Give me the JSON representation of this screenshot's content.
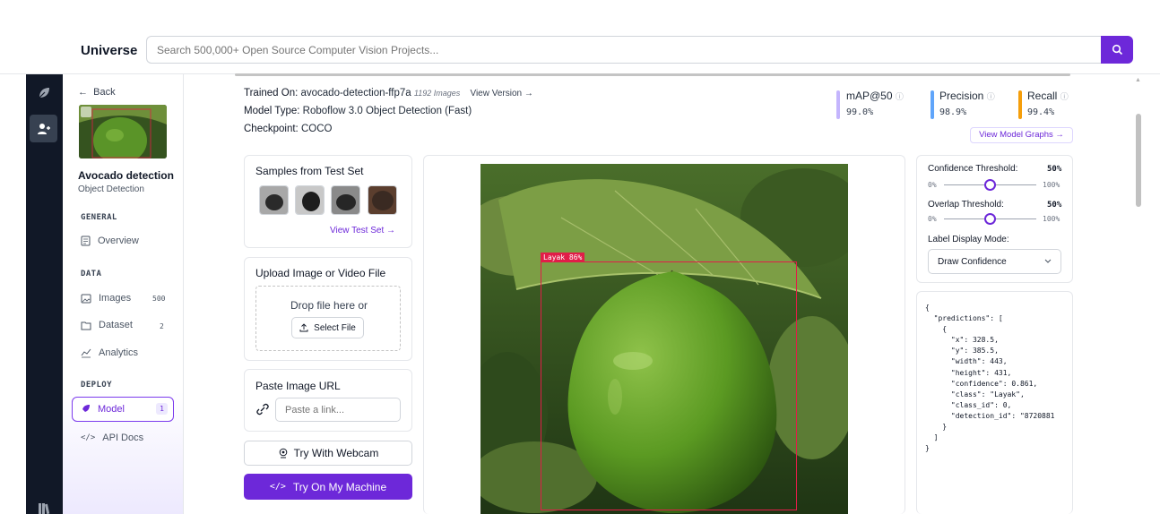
{
  "header": {
    "brand": "Universe",
    "search_placeholder": "Search 500,000+ Open Source Computer Vision Projects..."
  },
  "sidebar": {
    "back_label": "Back",
    "project_title": "Avocado detection",
    "project_type": "Object Detection",
    "sections": {
      "general": "GENERAL",
      "data": "DATA",
      "deploy": "DEPLOY"
    },
    "items": {
      "overview": "Overview",
      "images": "Images",
      "images_count": "500",
      "dataset": "Dataset",
      "dataset_count": "2",
      "analytics": "Analytics",
      "model": "Model",
      "model_count": "1",
      "api_docs": "API Docs"
    }
  },
  "model_info": {
    "trained_on_key": "Trained On:",
    "trained_on_value": "avocado-detection-ffp7a",
    "images_note": "1192 Images",
    "view_version": "View Version →",
    "model_type_key": "Model Type:",
    "model_type_value": "Roboflow 3.0 Object Detection (Fast)",
    "checkpoint_key": "Checkpoint:",
    "checkpoint_value": "COCO"
  },
  "metrics": {
    "map_label": "mAP@50",
    "map_value": "99.0%",
    "precision_label": "Precision",
    "precision_value": "98.9%",
    "recall_label": "Recall",
    "recall_value": "99.4%",
    "graphs_link": "View Model Graphs →",
    "colors": {
      "map": "#c4b5fd",
      "precision": "#60a5fa",
      "recall": "#f59e0b"
    }
  },
  "samples": {
    "title": "Samples from Test Set",
    "view_link": "View Test Set →"
  },
  "upload": {
    "title": "Upload Image or Video File",
    "drop_text": "Drop file here or",
    "select_button": "Select File"
  },
  "paste": {
    "title": "Paste Image URL",
    "placeholder": "Paste a link..."
  },
  "actions": {
    "webcam": "Try With Webcam",
    "machine": "Try On My Machine"
  },
  "detection": {
    "label": "Layak 86%"
  },
  "settings": {
    "confidence_label": "Confidence Threshold:",
    "confidence_value": "50%",
    "overlap_label": "Overlap Threshold:",
    "overlap_value": "50%",
    "slider_min": "0%",
    "slider_max": "100%",
    "confidence_level": 0.5,
    "overlap_level": 0.5,
    "label_mode_label": "Label Display Mode:",
    "label_mode_value": "Draw Confidence"
  },
  "json_output": "{\n  \"predictions\": [\n    {\n      \"x\": 328.5,\n      \"y\": 385.5,\n      \"width\": 443,\n      \"height\": 431,\n      \"confidence\": 0.861,\n      \"class\": \"Layak\",\n      \"class_id\": 0,\n      \"detection_id\": \"8720881\n    }\n  ]\n}",
  "theme": {
    "accent": "#6d28d9",
    "rail": "#111827",
    "bbox": "#e11d48"
  }
}
